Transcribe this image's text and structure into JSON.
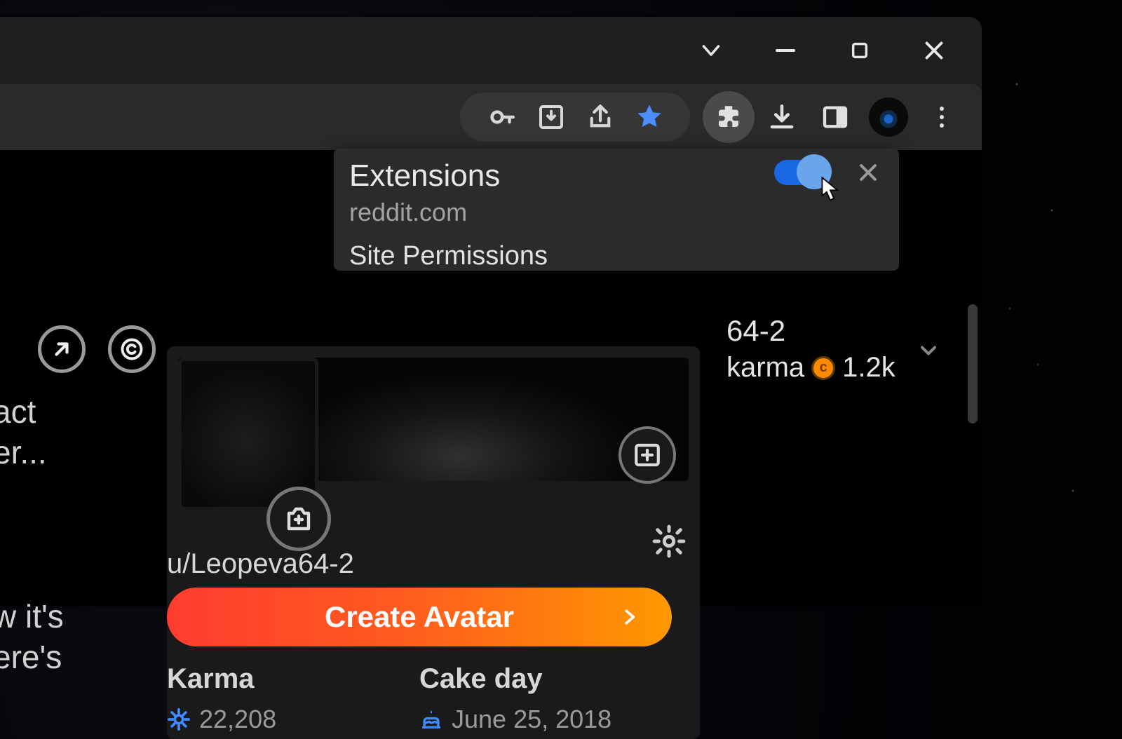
{
  "titlebar": {
    "dropdown": "▾",
    "min": "—",
    "max": "▢",
    "close": "✕"
  },
  "popover": {
    "title": "Extensions",
    "site": "reddit.com",
    "perm": "Site Permissions",
    "toggle_on": true
  },
  "right": {
    "username_fragment": "64-2",
    "karma_label": "karma",
    "coin_value": "1.2k"
  },
  "profile": {
    "username": "u/Leopeva64-2",
    "create_label": "Create Avatar",
    "karma_label": "Karma",
    "karma_value": "22,208",
    "cake_label": "Cake day",
    "cake_value": "June 25, 2018"
  },
  "left_snippets": {
    "a1": "act",
    "a2": "er...",
    "b1": "w it's",
    "b2": "ere's"
  }
}
